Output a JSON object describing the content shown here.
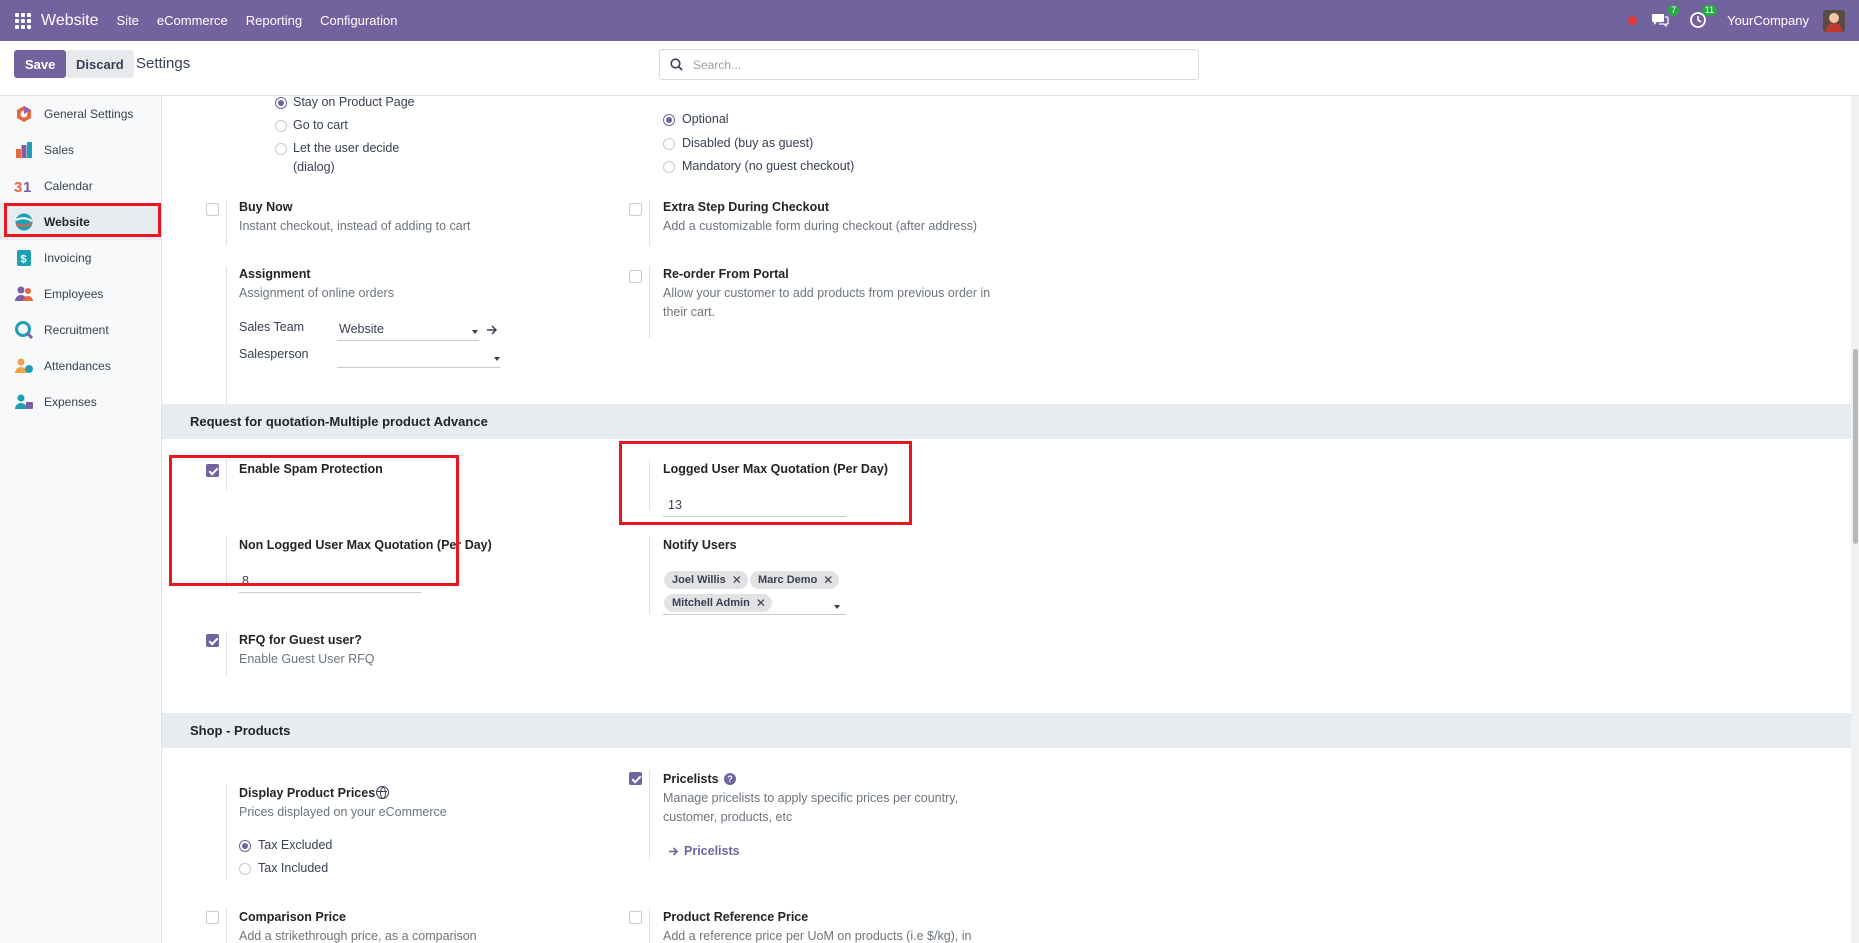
{
  "navbar": {
    "brand": "Website",
    "menu": [
      "Site",
      "eCommerce",
      "Reporting",
      "Configuration"
    ],
    "messages_count": "7",
    "activities_count": "11",
    "company": "YourCompany"
  },
  "controlbar": {
    "save_label": "Save",
    "discard_label": "Discard",
    "title": "Settings",
    "search_placeholder": "Search..."
  },
  "sidebar": {
    "items": [
      {
        "label": "General Settings",
        "icon": "odoo-icon",
        "color": "#e8663d"
      },
      {
        "label": "Sales",
        "icon": "sales-icon",
        "color": "#7b5ea7"
      },
      {
        "label": "Calendar",
        "icon": "calendar-icon",
        "color": "#e8663d"
      },
      {
        "label": "Website",
        "icon": "website-icon",
        "color": "#1f9fb6"
      },
      {
        "label": "Invoicing",
        "icon": "invoicing-icon",
        "color": "#1f9fb6"
      },
      {
        "label": "Employees",
        "icon": "employees-icon",
        "color": "#7b5ea7"
      },
      {
        "label": "Recruitment",
        "icon": "recruitment-icon",
        "color": "#1f9fb6"
      },
      {
        "label": "Attendances",
        "icon": "attendances-icon",
        "color": "#f0a24b"
      },
      {
        "label": "Expenses",
        "icon": "expenses-icon",
        "color": "#1f9fb6"
      }
    ],
    "active": "Website"
  },
  "cart_behavior": {
    "options": [
      "Stay on Product Page",
      "Go to cart",
      "Let the user decide",
      "(dialog)"
    ],
    "selected": "Stay on Product Page"
  },
  "checkout_login": {
    "options": [
      "Optional",
      "Disabled (buy as guest)",
      "Mandatory (no guest checkout)"
    ],
    "selected": "Optional"
  },
  "buy_now": {
    "title": "Buy Now",
    "desc": "Instant checkout, instead of adding to cart",
    "checked": false
  },
  "extra_step": {
    "title": "Extra Step During Checkout",
    "desc": "Add a customizable form during checkout (after address)",
    "checked": false
  },
  "assignment": {
    "title": "Assignment",
    "desc": "Assignment of online orders",
    "sales_team_label": "Sales Team",
    "sales_team_value": "Website",
    "salesperson_label": "Salesperson",
    "salesperson_value": ""
  },
  "reorder": {
    "title": "Re-order From Portal",
    "desc1": "Allow your customer to add products from previous order in",
    "desc2": "their cart.",
    "checked": false
  },
  "rfq_section": {
    "title": "Request for quotation-Multiple product Advance",
    "spam_protection": {
      "title": "Enable Spam Protection",
      "checked": true
    },
    "logged_max": {
      "title": "Logged User Max Quotation (Per Day)",
      "value": "13"
    },
    "non_logged_max": {
      "title": "Non Logged User Max Quotation (Per Day)",
      "value": "8"
    },
    "notify_users": {
      "title": "Notify Users",
      "tags": [
        "Joel Willis",
        "Marc Demo",
        "Mitchell Admin"
      ]
    },
    "rfq_guest": {
      "title": "RFQ for Guest user?",
      "desc": "Enable Guest User RFQ",
      "checked": true
    }
  },
  "shop_products": {
    "title": "Shop - Products",
    "display_prices": {
      "title": "Display Product Prices",
      "desc": "Prices displayed on your eCommerce",
      "options": [
        "Tax Excluded",
        "Tax Included"
      ],
      "selected": "Tax Excluded"
    },
    "pricelists": {
      "title": "Pricelists",
      "desc1": "Manage pricelists to apply specific prices per country,",
      "desc2": "customer, products, etc",
      "link": "Pricelists",
      "checked": true
    },
    "comparison_price": {
      "title": "Comparison Price",
      "desc": "Add a strikethrough price, as a comparison",
      "checked": false
    },
    "reference_price": {
      "title": "Product Reference Price",
      "desc": "Add a reference price per UoM on products (i.e $/kg), in",
      "checked": false
    }
  },
  "colors": {
    "brand": "#71639e",
    "highlight": "#e8161f"
  }
}
